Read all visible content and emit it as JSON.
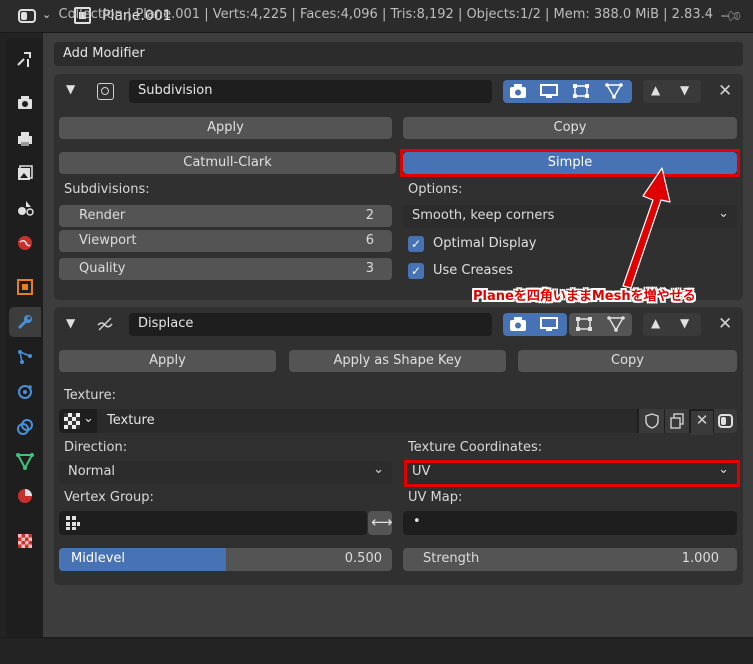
{
  "header": {
    "object_name": "Plane.001",
    "icons": [
      "editor-type-toggle-icon",
      "object-data-icon",
      "pin-icon"
    ]
  },
  "tabs": [
    {
      "name": "tool",
      "icon": "wrench-screwdriver-icon"
    },
    {
      "name": "render",
      "icon": "camera-back-icon"
    },
    {
      "name": "output",
      "icon": "printer-icon"
    },
    {
      "name": "view-layer",
      "icon": "image-stack-icon"
    },
    {
      "name": "scene",
      "icon": "scene-shapes-icon"
    },
    {
      "name": "world",
      "icon": "globe-icon"
    },
    {
      "name": "object",
      "icon": "object-square-icon"
    },
    {
      "name": "modifiers",
      "icon": "wrench-icon",
      "active": true
    },
    {
      "name": "particles",
      "icon": "particles-icon"
    },
    {
      "name": "physics",
      "icon": "physics-orbit-icon"
    },
    {
      "name": "constraints",
      "icon": "constraint-icon"
    },
    {
      "name": "data",
      "icon": "mesh-triangle-icon"
    },
    {
      "name": "material",
      "icon": "material-sphere-icon"
    },
    {
      "name": "texture",
      "icon": "checker-icon"
    }
  ],
  "add_modifier": "Add Modifier",
  "subdivision": {
    "name": "Subdivision",
    "apply": "Apply",
    "copy": "Copy",
    "type_catmull": "Catmull-Clark",
    "type_simple": "Simple",
    "subdivisions_label": "Subdivisions:",
    "render_label": "Render",
    "render_value": "2",
    "viewport_label": "Viewport",
    "viewport_value": "6",
    "quality_label": "Quality",
    "quality_value": "3",
    "options_label": "Options:",
    "uv_smooth": "Smooth, keep corners",
    "optimal_display": "Optimal Display",
    "use_creases": "Use Creases"
  },
  "annotation": {
    "text": "Planeを四角いままMeshを増やせる",
    "color": "#e00000"
  },
  "displace": {
    "name": "Displace",
    "apply": "Apply",
    "apply_shape_key": "Apply as Shape Key",
    "copy": "Copy",
    "texture_label": "Texture:",
    "texture_name": "Texture",
    "direction_label": "Direction:",
    "direction_value": "Normal",
    "tex_coords_label": "Texture Coordinates:",
    "tex_coords_value": "UV",
    "vertex_group_label": "Vertex Group:",
    "uv_map_label": "UV Map:",
    "uv_map_value": "•",
    "midlevel_label": "Midlevel",
    "midlevel_value": "0.500",
    "strength_label": "Strength",
    "strength_value": "1.000"
  },
  "status_bar": "Collection | Plane.001 | Verts:4,225 | Faces:4,096 | Tris:8,192 | Objects:1/2 | Mem: 388.0 MiB | 2.83.4",
  "colors": {
    "accent_blue": "#4772b3",
    "panel": "#303030",
    "annotation_red": "#e00000"
  }
}
